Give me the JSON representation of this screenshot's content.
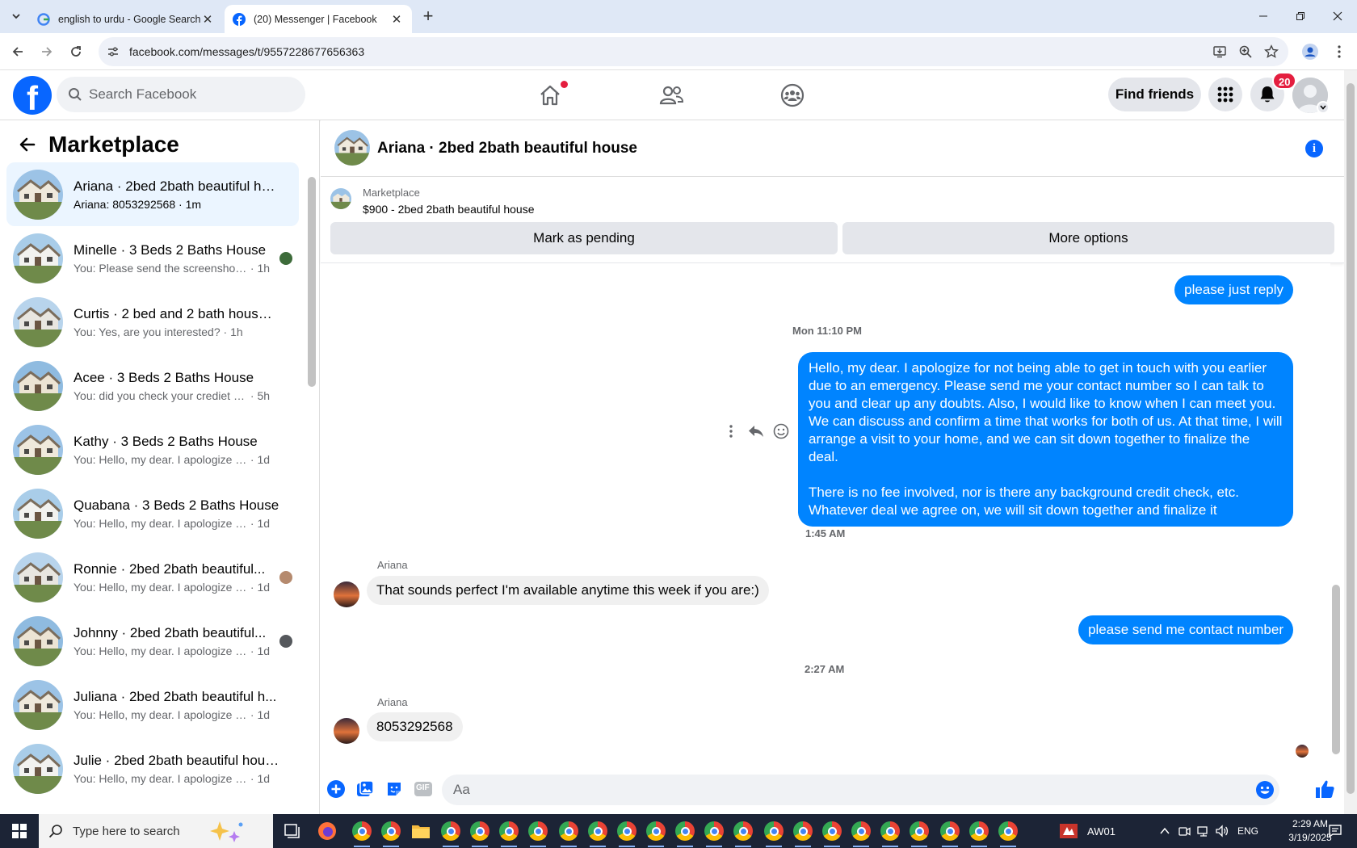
{
  "browser": {
    "tabs": [
      {
        "title": "english to urdu - Google Search",
        "active": false
      },
      {
        "title": "(20) Messenger | Facebook",
        "active": true
      }
    ],
    "url": "facebook.com/messages/t/9557228677656363"
  },
  "fb_header": {
    "search_placeholder": "Search Facebook",
    "find_friends_label": "Find friends",
    "notification_count": "20",
    "logo_letter": "f"
  },
  "sidebar": {
    "title": "Marketplace",
    "conversations": [
      {
        "name": "Ariana · 2bed 2bath beautiful ho...",
        "preview": "Ariana: 8053292568",
        "time": "1m",
        "selected": true
      },
      {
        "name": "Minelle · 3 Beds 2 Baths House",
        "preview": "You: Please send the screenshot ...",
        "time": "1h"
      },
      {
        "name": "Curtis · 2 bed and 2 bath house ...",
        "preview": "You: Yes, are you interested?",
        "time": "1h"
      },
      {
        "name": "Acee · 3 Beds 2 Baths House",
        "preview": "You: did you check your crediet sco...",
        "time": "5h"
      },
      {
        "name": "Kathy · 3 Beds 2 Baths House",
        "preview": "You: Hello, my dear. I apologize for ...",
        "time": "1d"
      },
      {
        "name": "Quabana · 3 Beds 2 Baths House",
        "preview": "You: Hello, my dear. I apologize for ...",
        "time": "1d"
      },
      {
        "name": "Ronnie · 2bed 2bath beautiful...",
        "preview": "You: Hello, my dear. I apologize f...",
        "time": "1d"
      },
      {
        "name": "Johnny · 2bed 2bath beautiful...",
        "preview": "You: Hello, my dear. I apologize f...",
        "time": "1d"
      },
      {
        "name": "Juliana · 2bed 2bath beautiful h...",
        "preview": "You: Hello, my dear. I apologize for ...",
        "time": "1d"
      },
      {
        "name": "Julie · 2bed 2bath beautiful house",
        "preview": "You: Hello, my dear. I apologize for ...",
        "time": "1d"
      }
    ]
  },
  "chat": {
    "title": "Ariana · 2bed 2bath beautiful house",
    "listing_category": "Marketplace",
    "listing_price_title": "$900 - 2bed 2bath beautiful house",
    "mark_pending_label": "Mark as pending",
    "more_options_label": "More options",
    "messages": {
      "out1": "please just reply",
      "ts1": "Mon 11:10 PM",
      "out2_p1": "Hello, my dear. I apologize for not being able to get in touch with you earlier due to an emergency. Please send me your contact number so I can talk to you and clear up any doubts. Also, I would like to know when I can meet you. We can discuss and confirm a time that works for both of us. At that time, I will arrange a visit to your home, and we can sit down together to finalize the deal.",
      "out2_p2": "There is no fee involved, nor is there any background credit check, etc. Whatever deal we agree on, we will sit down together and finalize it",
      "ts2": "1:45 AM",
      "in1_sender": "Ariana",
      "in1": "That sounds perfect I'm available anytime this week if you are:)",
      "out3": "please send me contact number",
      "ts3": "2:27 AM",
      "in2_sender": "Ariana",
      "in2": "8053292568"
    },
    "composer_placeholder": "Aa",
    "gif_label": "GIF"
  },
  "taskbar": {
    "search_placeholder": "Type here to search",
    "tray_label": "AW01",
    "language": "ENG",
    "time": "2:29 AM",
    "date": "3/19/2025"
  },
  "colors": {
    "facebook_blue": "#0866ff",
    "messenger_bubble": "#0084ff",
    "badge_red": "#e41e3f"
  }
}
